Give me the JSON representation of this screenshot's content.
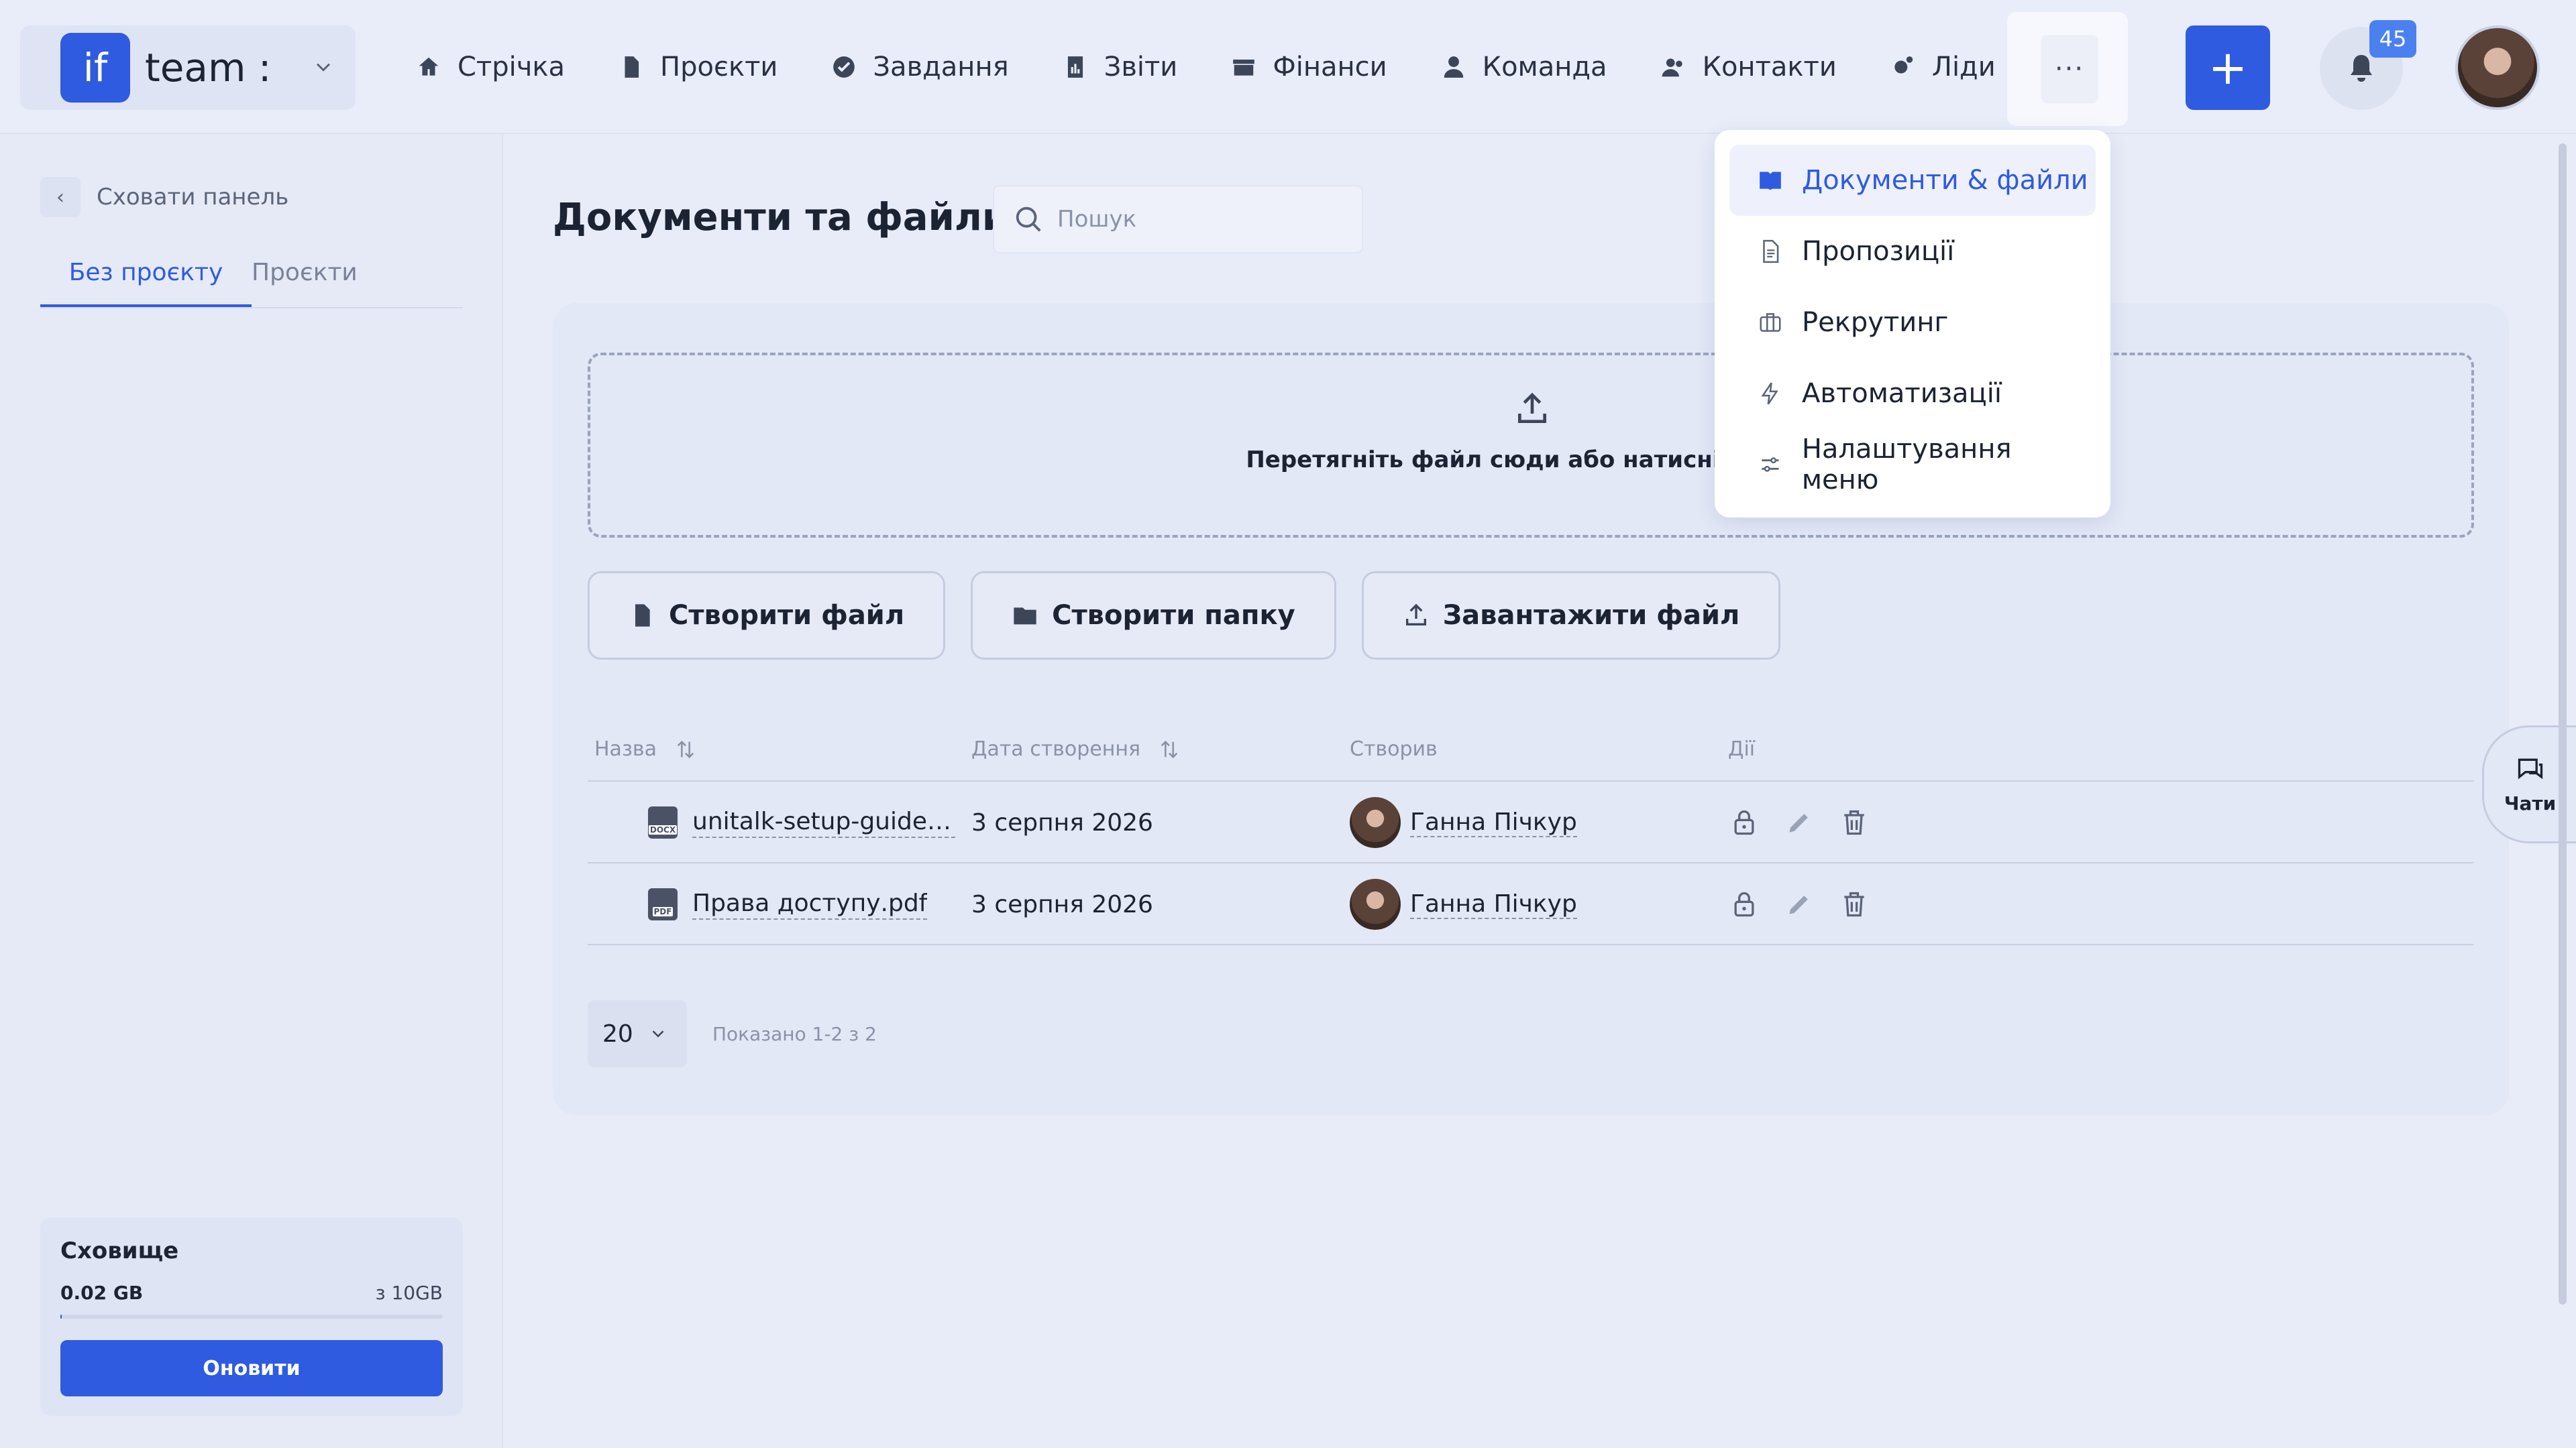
{
  "header": {
    "team_logo": "if",
    "team_name": "team :",
    "nav": [
      {
        "label": "Стрічка",
        "icon": "home-icon"
      },
      {
        "label": "Проєкти",
        "icon": "file-icon"
      },
      {
        "label": "Завдання",
        "icon": "check-circle-icon"
      },
      {
        "label": "Звіти",
        "icon": "report-icon"
      },
      {
        "label": "Фінанси",
        "icon": "wallet-icon"
      },
      {
        "label": "Команда",
        "icon": "user-icon"
      },
      {
        "label": "Контакти",
        "icon": "contacts-icon"
      },
      {
        "label": "Ліди",
        "icon": "leads-icon"
      }
    ],
    "more_label": "···",
    "plus_label": "+",
    "notifications_count": "45"
  },
  "dropdown": {
    "items": [
      {
        "label": "Документи & файли",
        "icon": "book-icon",
        "active": true
      },
      {
        "label": "Пропозиції",
        "icon": "document-icon"
      },
      {
        "label": "Рекрутинг",
        "icon": "briefcase-icon"
      },
      {
        "label": "Автоматизації",
        "icon": "lightning-icon"
      },
      {
        "label": "Налаштування меню",
        "icon": "sliders-icon"
      }
    ]
  },
  "sidebar": {
    "hide_label": "Сховати панель",
    "tabs": [
      "Без проєкту",
      "Проєкти"
    ],
    "storage": {
      "title": "Сховище",
      "used": "0.02 GB",
      "total": "з 10GB",
      "used_fraction": 0.002,
      "button": "Оновити"
    }
  },
  "main": {
    "title": "Документи та файли",
    "search_placeholder": "Пошук",
    "dropzone_text": "Перетягніть файл сюди або натисніть, щоб з",
    "actions": [
      "Створити файл",
      "Створити папку",
      "Завантажити файл"
    ],
    "columns": [
      "Назва",
      "Дата створення",
      "Створив",
      "Дії"
    ],
    "rows": [
      {
        "name": "unitalk-setup-guide.docx",
        "badge": "DOCX",
        "date": "3 серпня 2026",
        "author": "Ганна Пічкур"
      },
      {
        "name": "Права доступу.pdf",
        "badge": "PDF",
        "date": "3 серпня 2026",
        "author": "Ганна Пічкур"
      }
    ],
    "page_size": "20",
    "showing": "Показано 1-2 з 2"
  },
  "chats_label": "Чати",
  "colors": {
    "accent": "#2f5be0",
    "background": "#e8ecf8"
  }
}
